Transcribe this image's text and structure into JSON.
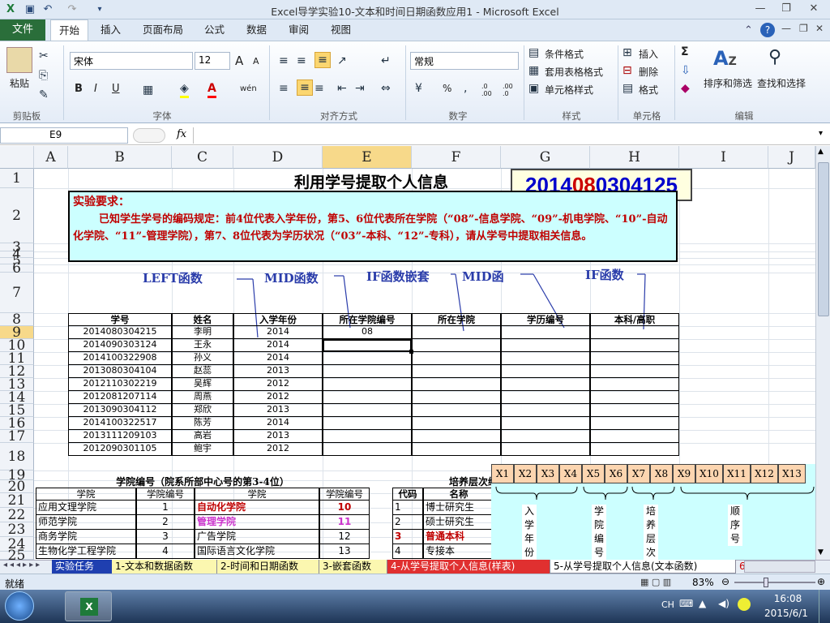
{
  "window": {
    "title": "Excel导学实验10-文本和时间日期函数应用1 - Microsoft Excel",
    "minimize": "—",
    "restore": "❐",
    "close": "✕"
  },
  "tabs": {
    "file": "文件",
    "items": [
      "开始",
      "插入",
      "页面布局",
      "公式",
      "数据",
      "审阅",
      "视图"
    ]
  },
  "ribbon": {
    "clipboard": {
      "paste": "粘贴",
      "label": "剪贴板"
    },
    "font": {
      "name": "宋体",
      "size": "12",
      "bold": "B",
      "italic": "I",
      "underline": "U",
      "grow": "A",
      "shrink": "A",
      "label": "字体",
      "wen": "wén"
    },
    "alignment": {
      "label": "对齐方式"
    },
    "number": {
      "format": "常规",
      "percent": "%",
      "label": "数字",
      "dec_inc": ".0 .00",
      "dec_dec": ".00 .0"
    },
    "styles": {
      "conditional": "条件格式",
      "table": "套用表格格式",
      "cell": "单元格样式",
      "label": "样式"
    },
    "cells": {
      "insert": "插入",
      "delete": "删除",
      "format": "格式",
      "label": "单元格"
    },
    "editing": {
      "sigma": "Σ",
      "sort": "排序和筛选",
      "find": "查找和选择",
      "label": "编辑"
    }
  },
  "formula_bar": {
    "name_box": "E9",
    "fx": "fx",
    "content": ""
  },
  "columns": [
    "A",
    "B",
    "C",
    "D",
    "E",
    "F",
    "G",
    "H",
    "I",
    "J"
  ],
  "rows": [
    "1",
    "2",
    "3",
    "4",
    "5",
    "6",
    "7",
    "8",
    "9",
    "10",
    "11",
    "12",
    "13",
    "14",
    "15",
    "16",
    "17",
    "18",
    "19",
    "20",
    "21",
    "22",
    "23",
    "24",
    "25"
  ],
  "sheet": {
    "title": "利用学号提取个人信息",
    "id_display": {
      "part1": "2014",
      "part2": "08",
      "part3": "03",
      "part4": "04125"
    },
    "requirement": {
      "head": "实验要求：",
      "body": "已知学生学号的编码规定：前4位代表入学年份，第5、6位代表所在学院（“08”-信息学院、“09”-机电学院、“10”-自动化学院、“11”-管理学院），第7、8位代表为学历状况（“03”-本科、“12”-专科），请从学号中提取相关信息。"
    },
    "hints": [
      "LEFT函数",
      "MID函数",
      "IF函数嵌套",
      "MID函",
      "IF函数"
    ],
    "table_headers": [
      "学号",
      "姓名",
      "入学年份",
      "所在学院编号",
      "所在学院",
      "学历编号",
      "本科/高职"
    ],
    "table_rows": [
      [
        "2014080304215",
        "李明",
        "2014",
        "08"
      ],
      [
        "2014090303124",
        "王永",
        "2014",
        ""
      ],
      [
        "2014100322908",
        "孙义",
        "2014",
        ""
      ],
      [
        "2013080304104",
        "赵蕊",
        "2013",
        ""
      ],
      [
        "2012110302219",
        "吴辉",
        "2012",
        ""
      ],
      [
        "2012081207114",
        "周燕",
        "2012",
        ""
      ],
      [
        "2013090304112",
        "郑欣",
        "2013",
        ""
      ],
      [
        "2014100322517",
        "陈芳",
        "2014",
        ""
      ],
      [
        "2013111209103",
        "高岩",
        "2013",
        ""
      ],
      [
        "2012090301105",
        "鲍宇",
        "2012",
        ""
      ]
    ],
    "college_table": {
      "title": "学院编号（院系所部中心号的第3-4位）",
      "headers": [
        "学院",
        "学院编号",
        "学院",
        "学院编号"
      ],
      "rows": [
        [
          "应用文理学院",
          "1",
          "自动化学院",
          "10"
        ],
        [
          "师范学院",
          "2",
          "管理学院",
          "11"
        ],
        [
          "商务学院",
          "3",
          "广告学院",
          "12"
        ],
        [
          "生物化学工程学院",
          "4",
          "国际语言文化学院",
          "13"
        ]
      ]
    },
    "level_table": {
      "title": "培养层次编",
      "headers": [
        "代码",
        "名称"
      ],
      "rows": [
        [
          "1",
          "博士研究生"
        ],
        [
          "2",
          "硕士研究生"
        ],
        [
          "3",
          "普通本科"
        ],
        [
          "4",
          "专接本"
        ]
      ]
    },
    "x_diagram": {
      "boxes": [
        "X1",
        "X2",
        "X3",
        "X4",
        "X5",
        "X6",
        "X7",
        "X8",
        "X9",
        "X10",
        "X11",
        "X12",
        "X13"
      ],
      "labels": [
        "入学年份",
        "学院编号",
        "培养层次",
        "顺序号"
      ]
    }
  },
  "sheet_tabs": [
    "实验任务",
    "1-文本和数据函数",
    "2-时间和日期函数",
    "3-嵌套函数",
    "4-从学号提取个人信息(样表)",
    "5-从学号提取个人信息(文本函数)",
    "6-"
  ],
  "status": {
    "ready": "就绪",
    "zoom": "83%"
  },
  "taskbar": {
    "lang": "CH",
    "time": "16:08",
    "date": "2015/6/1"
  },
  "colors": {
    "accent": "#2a6e3a",
    "title_red": "#c00000",
    "id_blue": "#0000cc",
    "id_red": "#cc0000",
    "pink": "#cc33cc",
    "cyan": "#ccffff"
  }
}
